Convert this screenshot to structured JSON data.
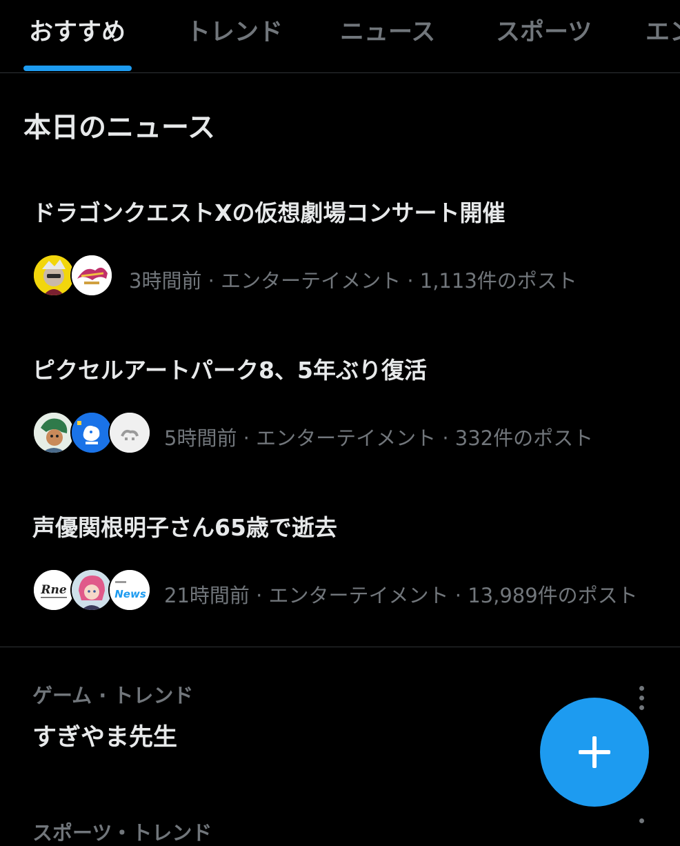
{
  "tabs": [
    {
      "label": "おすすめ",
      "active": true
    },
    {
      "label": "トレンド",
      "active": false
    },
    {
      "label": "ニュース",
      "active": false
    },
    {
      "label": "スポーツ",
      "active": false
    },
    {
      "label": "エン",
      "active": false
    }
  ],
  "section": {
    "title": "本日のニュース"
  },
  "news": [
    {
      "headline": "ドラゴンクエストXの仮想劇場コンサート開催",
      "meta": "3時間前 · エンターテイメント · 1,113件のポスト",
      "avatars": [
        "character-avatar",
        "logo-avatar"
      ]
    },
    {
      "headline": "ピクセルアートパーク8、5年ぶり復活",
      "meta": "5時間前 · エンターテイメント · 332件のポスト",
      "avatars": [
        "character-avatar",
        "pixel-avatar",
        "pixel-avatar"
      ]
    },
    {
      "headline": "声優関根明子さん65歳で逝去",
      "meta": "21時間前 · エンターテイメント · 13,989件のポスト",
      "avatars": [
        "news-logo-avatar",
        "character-avatar",
        "news-logo-avatar"
      ],
      "avatar_texts": [
        "Rne",
        "News"
      ]
    }
  ],
  "trend": {
    "category": "ゲーム · トレンド",
    "name": "すぎやま先生"
  },
  "next_trend": {
    "category": "スポーツ・トレンド"
  },
  "fab": {
    "icon": "plus-icon"
  },
  "colors": {
    "accent": "#1d9bf0",
    "background": "#000000",
    "text_primary": "#e7e9ea",
    "text_secondary": "#71767b"
  }
}
